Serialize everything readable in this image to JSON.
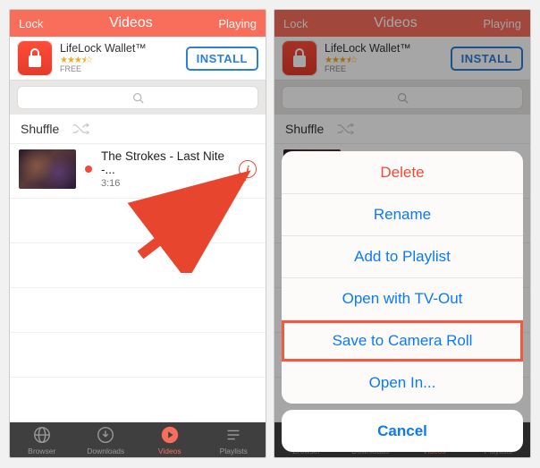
{
  "colors": {
    "accent": "#f86e5b",
    "link": "#0b79ff",
    "destructive": "#f24a36"
  },
  "nav": {
    "left": "Lock",
    "title": "Videos",
    "right": "Playing"
  },
  "ad": {
    "title": "LifeLock Wallet™",
    "stars_glyphs": "★★★⯨☆",
    "free_label": "FREE",
    "cta": "INSTALL",
    "icon_name": "lock-icon"
  },
  "search": {
    "placeholder": ""
  },
  "shuffle": {
    "label": "Shuffle"
  },
  "video": {
    "title": "The Strokes - Last Nite -...",
    "duration": "3:16",
    "info_glyph": "i"
  },
  "tabs": [
    {
      "name": "browser",
      "label": "Browser",
      "active": false
    },
    {
      "name": "downloads",
      "label": "Downloads",
      "active": false
    },
    {
      "name": "videos",
      "label": "Videos",
      "active": true
    },
    {
      "name": "playlists",
      "label": "Playlists",
      "active": false
    }
  ],
  "action_sheet": {
    "items": [
      {
        "label": "Delete",
        "destructive": true,
        "highlight": false
      },
      {
        "label": "Rename",
        "destructive": false,
        "highlight": false
      },
      {
        "label": "Add to Playlist",
        "destructive": false,
        "highlight": false
      },
      {
        "label": "Open with TV-Out",
        "destructive": false,
        "highlight": false
      },
      {
        "label": "Save to Camera Roll",
        "destructive": false,
        "highlight": true
      },
      {
        "label": "Open In...",
        "destructive": false,
        "highlight": false
      }
    ],
    "cancel": "Cancel"
  }
}
